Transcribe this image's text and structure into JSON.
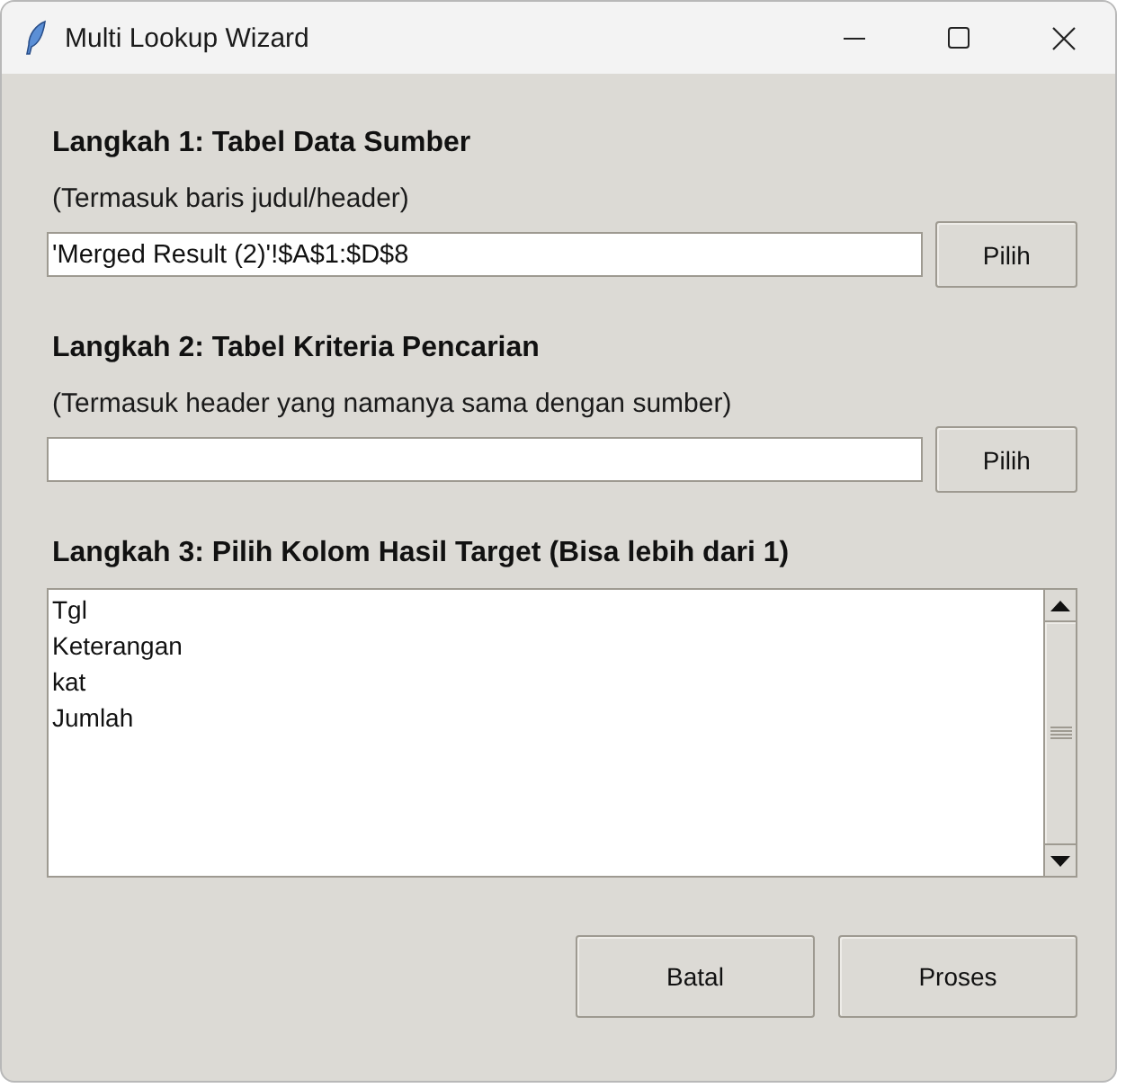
{
  "window": {
    "title": "Multi Lookup Wizard"
  },
  "steps": [
    {
      "heading": "Langkah 1: Tabel Data Sumber",
      "hint": "(Termasuk baris judul/header)",
      "field": {
        "value": "'Merged Result (2)'!$A$1:$D$8"
      },
      "button": "Pilih"
    },
    {
      "heading": "Langkah 2: Tabel Kriteria Pencarian",
      "hint": "(Termasuk header yang namanya sama dengan sumber)",
      "button": "Pilih"
    }
  ],
  "target_columns": {
    "heading": "Langkah 3: Pilih Kolom Hasil Target (Bisa lebih dari 1)",
    "items": [
      {
        "label": "Tgl",
        "selected": false
      },
      {
        "label": "Keterangan",
        "selected": false
      },
      {
        "label": "kat",
        "selected": false
      },
      {
        "label": "Jumlah",
        "selected": false
      }
    ]
  },
  "buttons": [
    "Batal",
    "Proses"
  ]
}
